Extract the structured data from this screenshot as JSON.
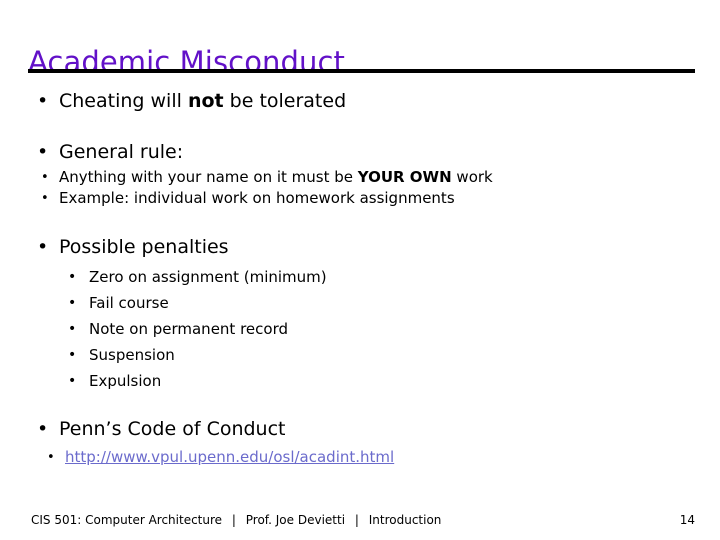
{
  "slide": {
    "title": "Academic Misconduct",
    "title_color": "#6211C8",
    "rule_color": "#000000",
    "link_color": "#6B6BCC",
    "background_color": "#FFFFFF"
  },
  "bullets": {
    "cheating": {
      "marker": "•",
      "pre": "Cheating will ",
      "bold": "not",
      "post": " be tolerated"
    },
    "general_rule": {
      "marker": "•",
      "label": "General rule:",
      "sub": [
        {
          "marker": "•",
          "pre": "Anything with your name on it must be ",
          "bold": "YOUR OWN",
          "post": " work"
        },
        {
          "marker": "•",
          "pre": "Example: individual work on homework assignments",
          "bold": "",
          "post": ""
        }
      ]
    },
    "penalties": {
      "marker": "•",
      "label": "Possible penalties",
      "items": [
        {
          "marker": "•",
          "text": "Zero on assignment (minimum)"
        },
        {
          "marker": "•",
          "text": "Fail course"
        },
        {
          "marker": "•",
          "text": "Note on permanent record"
        },
        {
          "marker": "•",
          "text": "Suspension"
        },
        {
          "marker": "•",
          "text": "Expulsion"
        }
      ]
    },
    "code_of_conduct": {
      "marker": "•",
      "label": "Penn’s Code of Conduct",
      "link": {
        "marker": "•",
        "text": "http://www.vpul.upenn.edu/osl/acadint.html"
      }
    }
  },
  "footer": {
    "course": "CIS 501: Computer Architecture",
    "separator": "|",
    "instructor": "Prof. Joe Devietti",
    "section": "Introduction",
    "page_number": "14"
  }
}
